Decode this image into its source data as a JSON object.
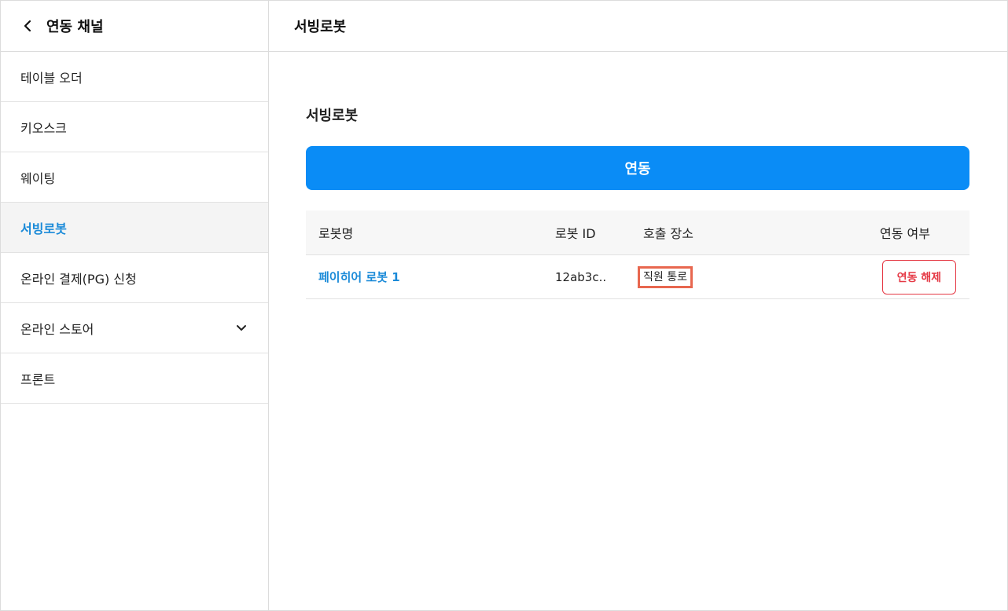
{
  "sidebar": {
    "title": "연동 채널",
    "items": [
      {
        "label": "테이블 오더"
      },
      {
        "label": "키오스크"
      },
      {
        "label": "웨이팅"
      },
      {
        "label": "서빙로봇"
      },
      {
        "label": "온라인 결제(PG) 신청"
      },
      {
        "label": "온라인 스토어"
      },
      {
        "label": "프론트"
      }
    ]
  },
  "header": {
    "title": "서빙로봇"
  },
  "main": {
    "section_title": "서빙로봇",
    "link_button": "연동",
    "table": {
      "headers": [
        "로봇명",
        "로봇 ID",
        "호출 장소",
        "연동 여부"
      ],
      "rows": [
        {
          "name": "페이히어 로봇 1",
          "id": "12ab3c..",
          "place": "직원 통로",
          "action": "연동 해제"
        }
      ]
    }
  },
  "colors": {
    "accent": "#0a8cf6",
    "active_text": "#1a8ad8",
    "danger": "#e53945",
    "highlight_border": "#e8674f"
  },
  "icons": {
    "back": "chevron-left-icon",
    "expand": "chevron-down-icon"
  }
}
